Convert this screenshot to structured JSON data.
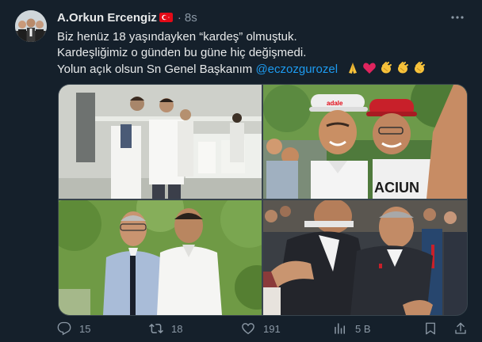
{
  "author": {
    "name": "A.Orkun Ercengiz",
    "flag_icon": "turkey-flag-icon",
    "separator": "·",
    "time": "8s"
  },
  "tweet": {
    "line1": "Biz henüz 18 yaşındayken “kardeş” olmuştuk.",
    "line2": "Kardeşliğimiz o günden bu güne hiç değişmedi.",
    "line3_text": "Yolun açık olsun Sn Genel Başkanım ",
    "mention": "@eczozgurozel",
    "emojis": [
      "folded-hands-icon",
      "red-heart-icon",
      "clapping-hands-icon",
      "clapping-hands-icon",
      "clapping-hands-icon"
    ]
  },
  "photos": {
    "shirt_text": "ACIUN",
    "cap_text": "adale"
  },
  "actions": {
    "replies": "15",
    "retweets": "18",
    "likes": "191",
    "views": "5 B"
  },
  "colors": {
    "background": "#15202b",
    "text": "#e7e9ea",
    "secondary": "#8b98a5",
    "accent": "#1d9bf0",
    "flag_red": "#e30a17"
  }
}
